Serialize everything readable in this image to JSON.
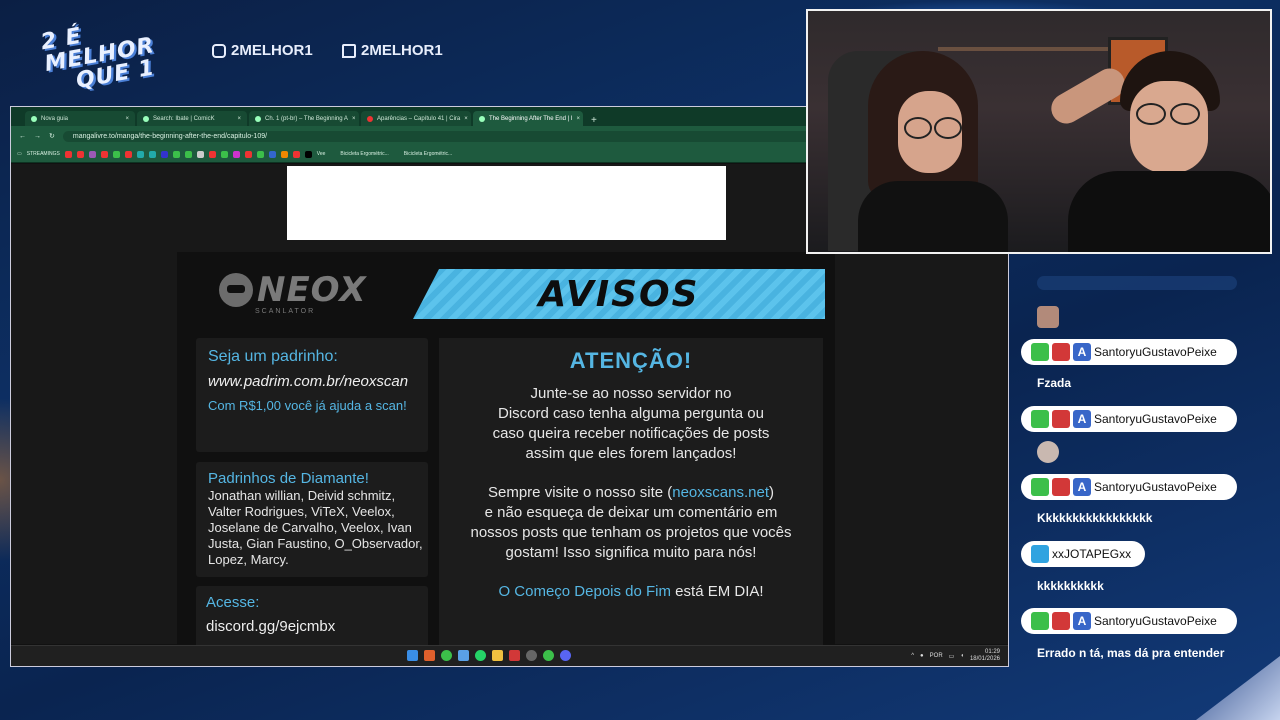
{
  "branding": {
    "logo_line1": "2 É MELHOR",
    "logo_line2": "QUE 1",
    "instagram": "2MELHOR1",
    "twitch": "2MELHOR1"
  },
  "browser": {
    "tabs": [
      {
        "label": "Nova guia"
      },
      {
        "label": "Search: Ibate | ComicK"
      },
      {
        "label": "Ch. 1 (pt-br) – The Beginning A"
      },
      {
        "label": "Aparências – Capítulo 41 | Cira"
      },
      {
        "label": "The Beginning After The End | I",
        "active": true
      }
    ],
    "new_tab_symbol": "+",
    "url": "mangalivre.to/manga/the-beginning-after-the-end/capitulo-109/",
    "bookmarks": {
      "first": "STREAMINGS",
      "third_last": "Vee",
      "second_last": "Bicicleta Ergométric...",
      "last": "Bicicleta Ergométric..."
    }
  },
  "banner": {
    "brand_name": "NEOX",
    "brand_sub": "SCANLATOR",
    "avisos": "AVISOS",
    "padrinho": {
      "heading": "Seja um padrinho:",
      "url": "www.padrim.com.br/neoxscan",
      "note": "Com R$1,00 você já ajuda a scan!"
    },
    "diamante": {
      "heading": "Padrinhos de Diamante!",
      "names": "Jonathan willian, Deivid schmitz, Valter Rodrigues, ViTeX, Veelox, Joselane de  Carvalho, Veelox, Ivan Justa, Gian Faustino, O_Observador, Lopez, Marcy."
    },
    "acesse": {
      "heading": "Acesse:",
      "link": "discord.gg/9ejcmbx"
    },
    "atencao": {
      "title": "ATENÇÃO!",
      "p1_l1": "Junte-se ao nosso servidor no",
      "p1_l2": "Discord caso tenha alguma pergunta ou",
      "p1_l3": "caso queira receber notificações de posts",
      "p1_l4": "assim que eles forem lançados!",
      "p2_l1_pre": "Sempre visite o nosso site (",
      "p2_l1_link": "neoxscans.net",
      "p2_l1_post": ")",
      "p2_l2": "e não esqueça de deixar um comentário em",
      "p2_l3": "nossos posts que tenham os projetos que vocês",
      "p2_l4": "gostam! Isso significa muito para nós!",
      "p3_link": "O Começo Depois do Fim",
      "p3_post": " está EM DIA!"
    }
  },
  "taskbar": {
    "lang": "POR",
    "time": "01:29",
    "date": "18/01/2026"
  },
  "chat": {
    "messages": [
      {
        "user": "SantoryuGustavoPeixe",
        "text": "Fzada"
      },
      {
        "user": "SantoryuGustavoPeixe",
        "text": ""
      },
      {
        "user": "SantoryuGustavoPeixe",
        "text": "Kkkkkkkkkkkkkkkkk"
      },
      {
        "user": "xxJOTAPEGxx",
        "text": "kkkkkkkkkk"
      },
      {
        "user": "SantoryuGustavoPeixe",
        "text": "Errado n tá, mas dá pra entender"
      }
    ],
    "badge_letter": "A"
  },
  "colors": {
    "accent_blue": "#55b6e3",
    "browser_green": "#1e5a3e"
  }
}
